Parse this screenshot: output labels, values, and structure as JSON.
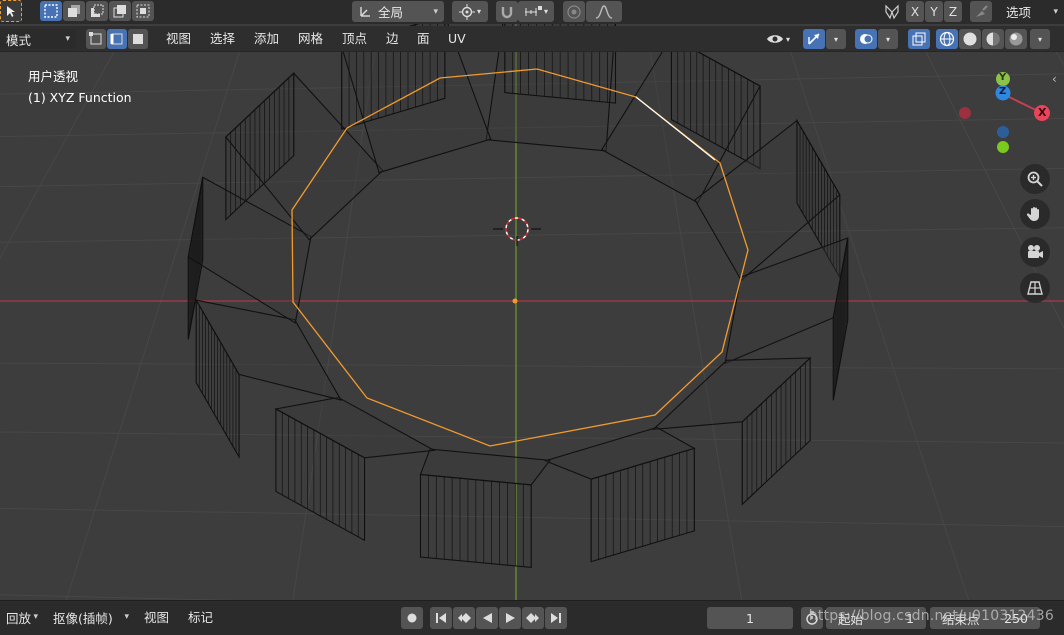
{
  "topbar": {
    "transform_orientation": "全局",
    "axis_x": "X",
    "axis_y": "Y",
    "axis_z": "Z",
    "options_label": "选项"
  },
  "header": {
    "mode_label": "模式",
    "menus": [
      "视图",
      "选择",
      "添加",
      "网格",
      "顶点",
      "边",
      "面",
      "UV"
    ]
  },
  "viewport": {
    "view_name": "用户透视",
    "object_info": "(1) XYZ Function",
    "gizmo": {
      "x": "X",
      "y": "Y",
      "z": "Z"
    }
  },
  "footer": {
    "playback_label": "回放",
    "keying_label": "抠像(插帧)",
    "view_label": "视图",
    "marker_label": "标记",
    "current_frame": "1",
    "start_label": "起始",
    "start_value": "1",
    "end_label": "结束点",
    "end_value": "250"
  },
  "watermark": "https://blog.csdn.net/u010312436",
  "colors": {
    "background": "#3d3d3d",
    "grid": "#4a4a4a",
    "x_axis": "#c4404f",
    "y_axis": "#8bc34a",
    "selection": "#f29a2e",
    "active_button": "#4772b3"
  }
}
